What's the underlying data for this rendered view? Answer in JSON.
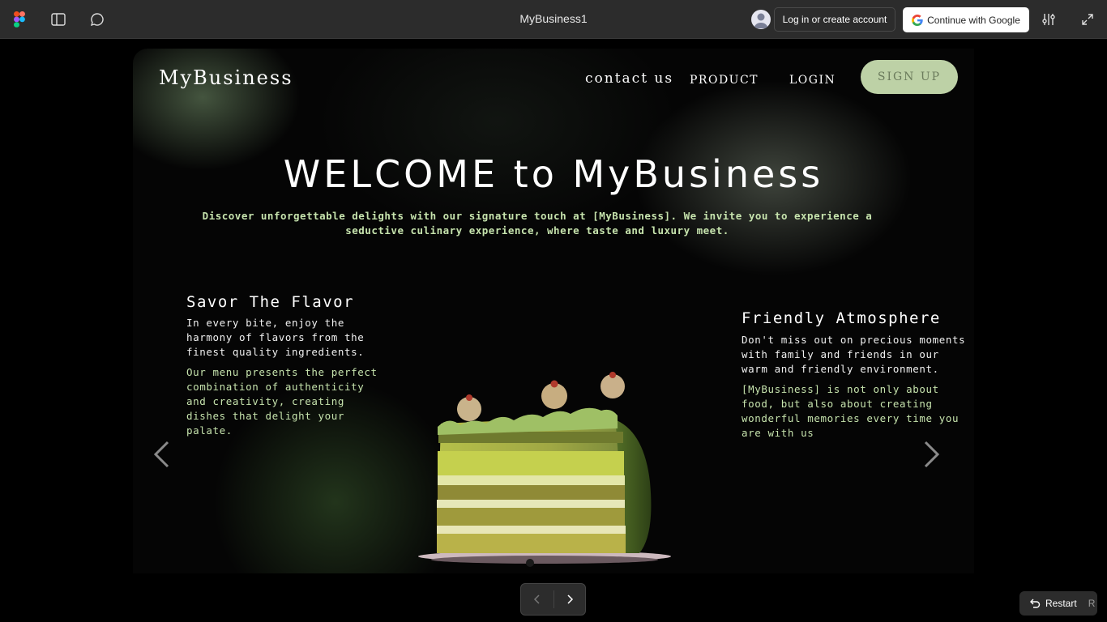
{
  "figma_bar": {
    "file_title": "MyBusiness1",
    "login_label": "Log in or create account",
    "google_label": "Continue with Google"
  },
  "site": {
    "brand": "MyBusiness",
    "nav": {
      "contact": "contact us",
      "product": "PRODUCT",
      "login": "LOGIN",
      "signup": "SIGN UP"
    },
    "hero": {
      "title": "WELCOME to MyBusiness",
      "subtitle": "Discover unforgettable delights with our signature touch at [MyBusiness]. We invite you to experience a seductive culinary experience, where taste and luxury meet."
    },
    "left_column": {
      "title": "Savor The Flavor",
      "p1": "In every bite, enjoy the harmony of flavors from the finest quality ingredients.",
      "p2": "Our menu presents the perfect combination of authenticity and creativity, creating dishes that delight your palate."
    },
    "right_column": {
      "title": "Friendly Atmosphere",
      "p1": "Don't miss out on precious moments with family and friends in our warm and friendly environment.",
      "p2": "[MyBusiness] is not only about food, but also about creating wonderful memories every time you are with us"
    }
  },
  "controls": {
    "restart_label": "Restart",
    "restart_key": "R"
  },
  "colors": {
    "accent_green": "#c6e3ad",
    "signup_bg": "#bdd1a6",
    "toolbar_bg": "#2c2c2c"
  },
  "icons": [
    "figma-logo-icon",
    "sidebar-toggle-icon",
    "comment-icon",
    "avatar-icon",
    "google-logo-icon",
    "settings-sliders-icon",
    "expand-icon",
    "chevron-left-icon",
    "chevron-right-icon",
    "restart-icon"
  ]
}
